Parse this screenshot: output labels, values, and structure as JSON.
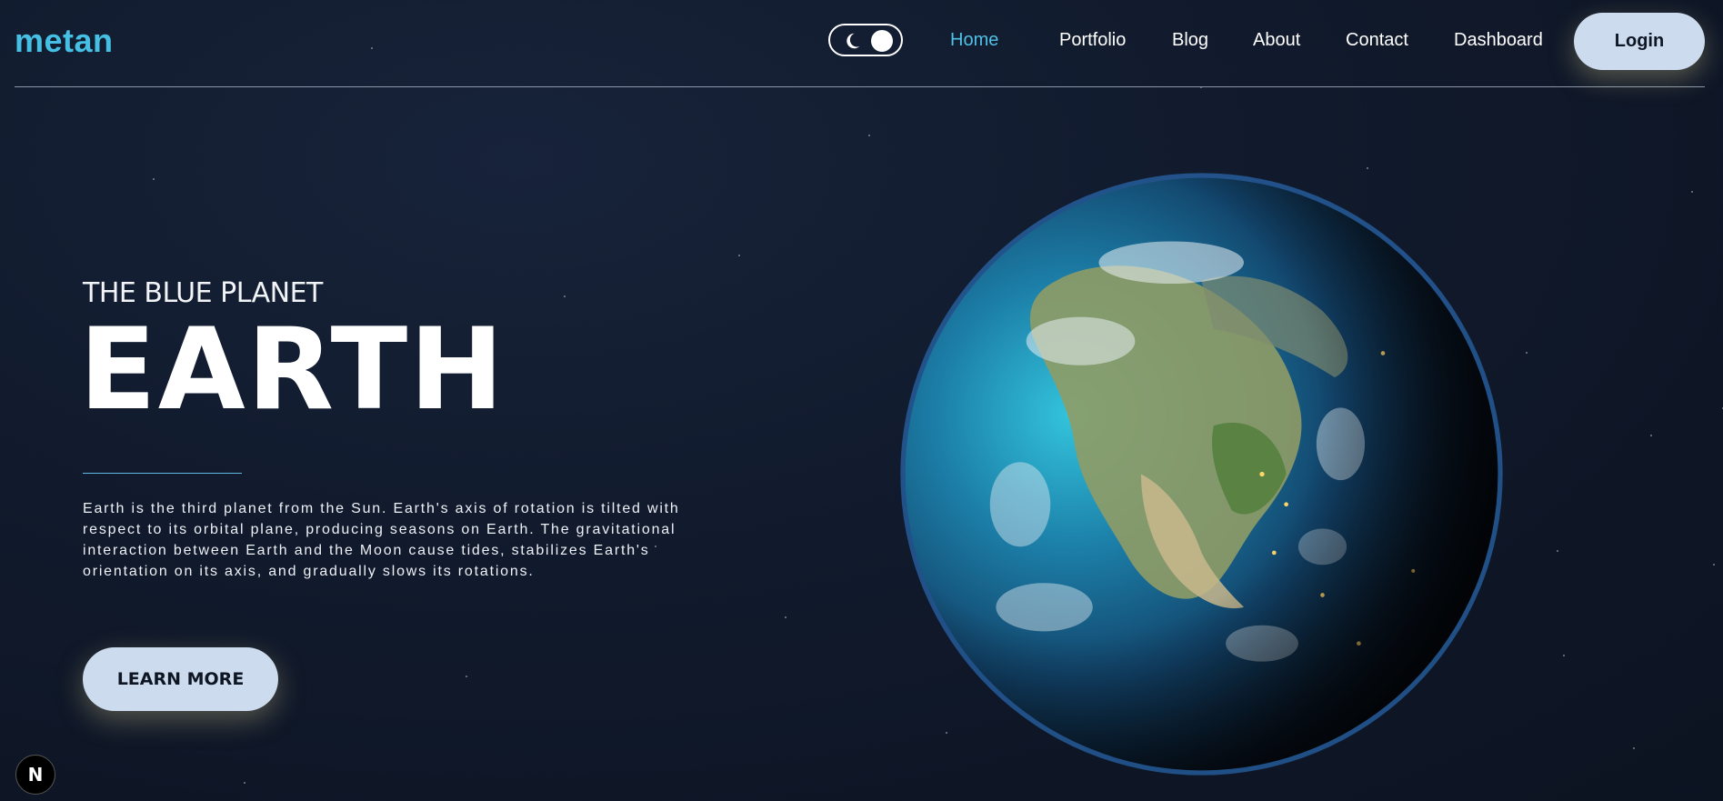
{
  "header": {
    "logo": "metan",
    "nav": [
      {
        "label": "Home",
        "active": true
      },
      {
        "label": "Portfolio",
        "active": false
      },
      {
        "label": "Blog",
        "active": false
      },
      {
        "label": "About",
        "active": false
      },
      {
        "label": "Contact",
        "active": false
      },
      {
        "label": "Dashboard",
        "active": false
      }
    ],
    "login_label": "Login",
    "theme_toggle_icons": [
      "moon-icon",
      "sun-icon"
    ]
  },
  "hero": {
    "eyebrow": "THE BLUE PLANET",
    "title": "EARTH",
    "description": "Earth is the third planet from the Sun. Earth's axis of rotation is tilted with respect to its orbital plane, producing seasons on Earth. The gravitational interaction between Earth and the Moon cause tides, stabilizes Earth's orientation on its axis, and gradually slows its rotations.",
    "cta_label": "LEARN MORE",
    "image": "earth-globe"
  },
  "badge": {
    "label": "N"
  },
  "colors": {
    "accent": "#4fc1e6",
    "background": "#111a2c",
    "button_bg": "#ccdcee",
    "button_text": "#0e1523"
  }
}
